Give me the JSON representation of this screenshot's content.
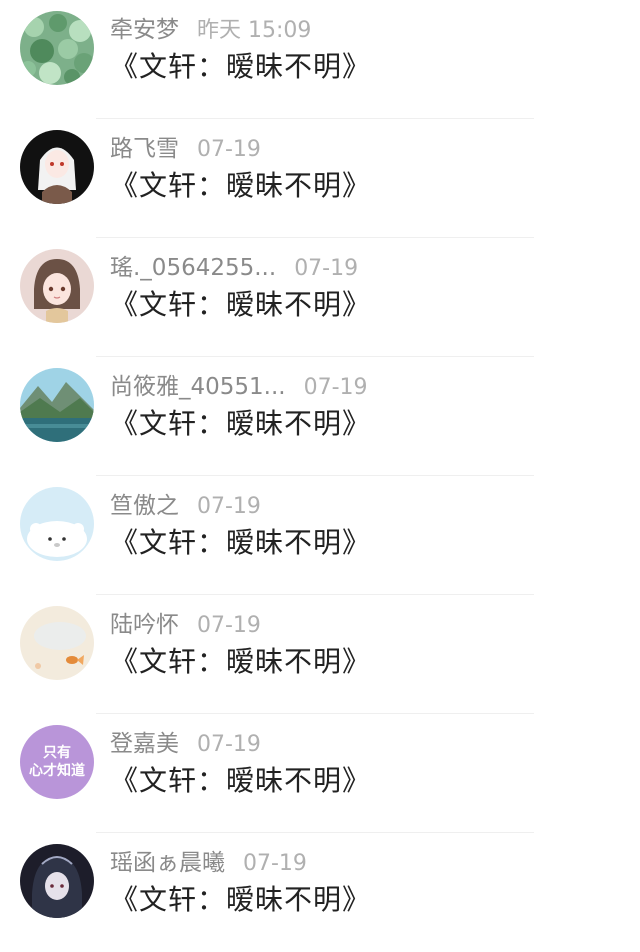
{
  "chats": [
    {
      "name": "牵安梦",
      "time": "昨天 15:09",
      "message": "《文轩：暧昧不明》",
      "avatar": "clover-leaves-avatar"
    },
    {
      "name": "路飞雪",
      "time": "07-19",
      "message": "《文轩：暧昧不明》",
      "avatar": "anime-white-hair-avatar"
    },
    {
      "name": "瑤._0564255...",
      "time": "07-19",
      "message": "《文轩：暧昧不明》",
      "avatar": "anime-girl-avatar"
    },
    {
      "name": "尚筱雅_40551...",
      "time": "07-19",
      "message": "《文轩：暧昧不明》",
      "avatar": "lake-landscape-avatar"
    },
    {
      "name": "笪傲之",
      "time": "07-19",
      "message": "《文轩：暧昧不明》",
      "avatar": "white-bear-avatar"
    },
    {
      "name": "陆吟怀",
      "time": "07-19",
      "message": "《文轩：暧昧不明》",
      "avatar": "goldfish-pastel-avatar"
    },
    {
      "name": "登嘉美",
      "time": "07-19",
      "message": "《文轩：暧昧不明》",
      "avatar": "text-avatar",
      "avatar_text": [
        "只有",
        "心才知道"
      ],
      "avatar_color": "#b995d9"
    },
    {
      "name": "瑶函ぁ晨曦",
      "time": "07-19",
      "message": "《文轩：暧昧不明》",
      "avatar": "anime-dark-hood-avatar"
    }
  ]
}
